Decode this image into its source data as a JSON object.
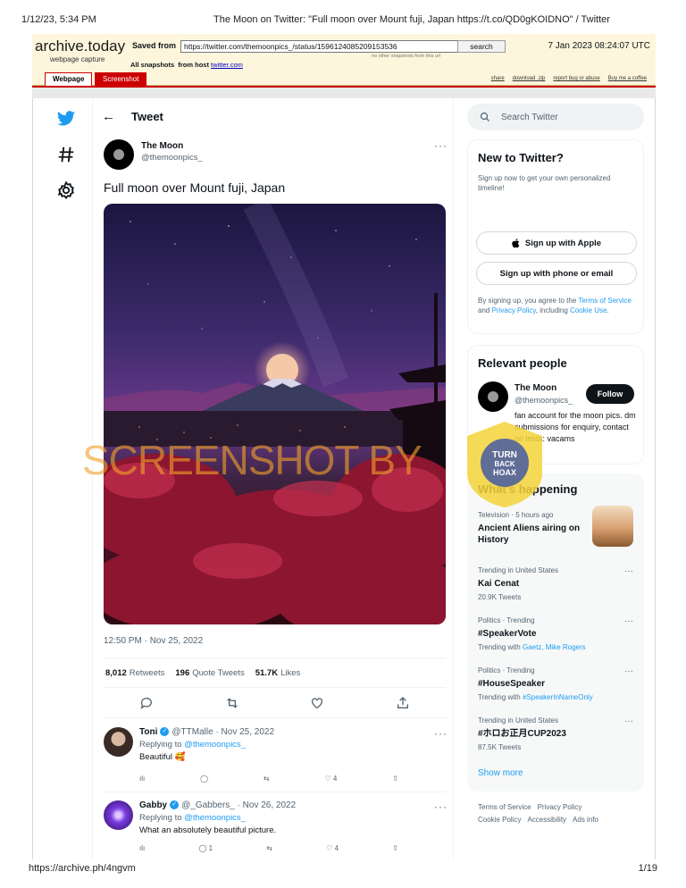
{
  "print_header": {
    "datetime": "1/12/23, 5:34 PM",
    "title": "The Moon on Twitter: \"Full moon over Mount fuji, Japan https://t.co/QD0gKOIDNO\" / Twitter"
  },
  "print_footer": {
    "url": "https://archive.ph/4ngvm",
    "page": "1/19"
  },
  "archive": {
    "logo": "archive.today",
    "logo_sub": "webpage capture",
    "saved_from_label": "Saved from",
    "url": "https://twitter.com/themoonpics_/status/1596124085209153536",
    "no_other": "no other snapshots from this url",
    "search_label": "search",
    "timestamp": "7 Jan 2023 08:24:07 UTC",
    "all_snapshots_label": "All snapshots",
    "from_host_label": "from host",
    "host": "twitter.com",
    "tab_webpage": "Webpage",
    "tab_screenshot": "Screenshot",
    "link_share": "share",
    "link_download": "download .zip",
    "link_report": "report bug or abuse",
    "link_coffee": "Buy me a coffee"
  },
  "tweet": {
    "header": "Tweet",
    "author_name": "The Moon",
    "author_handle": "@themoonpics_",
    "text": "Full moon over Mount fuji, Japan",
    "time": "12:50 PM · Nov 25, 2022",
    "retweets_count": "8,012",
    "retweets_label": "Retweets",
    "quotes_count": "196",
    "quotes_label": "Quote Tweets",
    "likes_count": "51.7K",
    "likes_label": "Likes"
  },
  "replies": [
    {
      "name": "Toni",
      "handle": "@TTMalle",
      "date": "· Nov 25, 2022",
      "replying_label": "Replying to",
      "replying_to": "@themoonpics_",
      "text": "Beautiful 🥰",
      "reply_count": "",
      "like_count": "4"
    },
    {
      "name": "Gabby",
      "handle": "@_Gabbers_",
      "date": "· Nov 26, 2022",
      "replying_label": "Replying to",
      "replying_to": "@themoonpics_",
      "text": "What an absolutely beautiful picture.",
      "reply_count": "1",
      "like_count": "4"
    }
  ],
  "sidebar": {
    "search_placeholder": "Search Twitter",
    "new_title": "New to Twitter?",
    "new_sub": "Sign up now to get your own personalized timeline!",
    "apple_btn": "Sign up with Apple",
    "phone_btn": "Sign up with phone or email",
    "legal_pre": "By signing up, you agree to the",
    "legal_terms": "Terms of Service",
    "legal_and": "and",
    "legal_privacy": "Privacy Policy",
    "legal_incl": ", including",
    "legal_cookie": "Cookie Use",
    "legal_end": ".",
    "relevant_title": "Relevant people",
    "rel_name": "The Moon",
    "rel_handle": "@themoonpics_",
    "follow_btn": "Follow",
    "rel_bio": "fan account for the moon pics. dm submissions for enquiry, contact on insta: vacams",
    "happening_title": "What's happening",
    "trends": [
      {
        "meta": "Television · 5 hours ago",
        "title": "Ancient Aliens airing on History",
        "count": "",
        "with_label": "",
        "with": ""
      },
      {
        "meta": "Trending in United States",
        "title": "Kai Cenat",
        "count": "20.9K Tweets",
        "with_label": "",
        "with": ""
      },
      {
        "meta": "Politics · Trending",
        "title": "#SpeakerVote",
        "count": "",
        "with_label": "Trending with",
        "with": "Gaetz, Mike Rogers"
      },
      {
        "meta": "Politics · Trending",
        "title": "#HouseSpeaker",
        "count": "",
        "with_label": "Trending with",
        "with": "#SpeakerInNameOnly"
      },
      {
        "meta": "Trending in United States",
        "title": "#ホロお正月CUP2023",
        "count": "87.5K Tweets",
        "with_label": "",
        "with": ""
      }
    ],
    "show_more": "Show more",
    "footer_links": [
      "Terms of Service",
      "Privacy Policy",
      "Cookie Policy",
      "Accessibility",
      "Ads info"
    ]
  },
  "overlay": {
    "watermark": "SCREENSHOT BY",
    "seal_top": "TURN",
    "seal_mid": "BACK",
    "seal_bot": "HOAX",
    "seal_ring": "MASYARAKAT ANTI FITNAH INDONESIA"
  },
  "colors": {
    "twitter_blue": "#1d9bf0",
    "archive_red": "#cc0000",
    "watermark_orange": "#f0a028"
  }
}
